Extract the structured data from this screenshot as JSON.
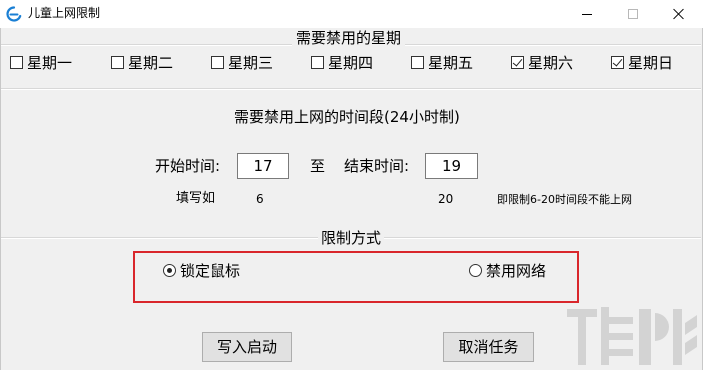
{
  "window": {
    "title": "儿童上网限制",
    "icon": "app-logo-icon"
  },
  "weekdays_group": {
    "title": "需要禁用的星期",
    "days": [
      {
        "label": "星期一",
        "checked": false
      },
      {
        "label": "星期二",
        "checked": false
      },
      {
        "label": "星期三",
        "checked": false
      },
      {
        "label": "星期四",
        "checked": false
      },
      {
        "label": "星期五",
        "checked": false
      },
      {
        "label": "星期六",
        "checked": true
      },
      {
        "label": "星期日",
        "checked": true
      }
    ]
  },
  "time_group": {
    "title": "需要禁用上网的时间段(24小时制)",
    "start_label": "开始时间:",
    "start_value": "17",
    "to_label": "至",
    "end_label": "结束时间:",
    "end_value": "19",
    "example_label": "填写如",
    "example_start": "6",
    "example_end": "20",
    "example_note": "即限制6-20时间段不能上网"
  },
  "mode_group": {
    "title": "限制方式",
    "options": [
      {
        "label": "锁定鼠标",
        "selected": true
      },
      {
        "label": "禁用网络",
        "selected": false
      }
    ]
  },
  "buttons": {
    "apply": "写入启动",
    "cancel": "取消任务"
  },
  "colors": {
    "highlight": "#d9262b",
    "window_bg": "#f0f0f0"
  }
}
